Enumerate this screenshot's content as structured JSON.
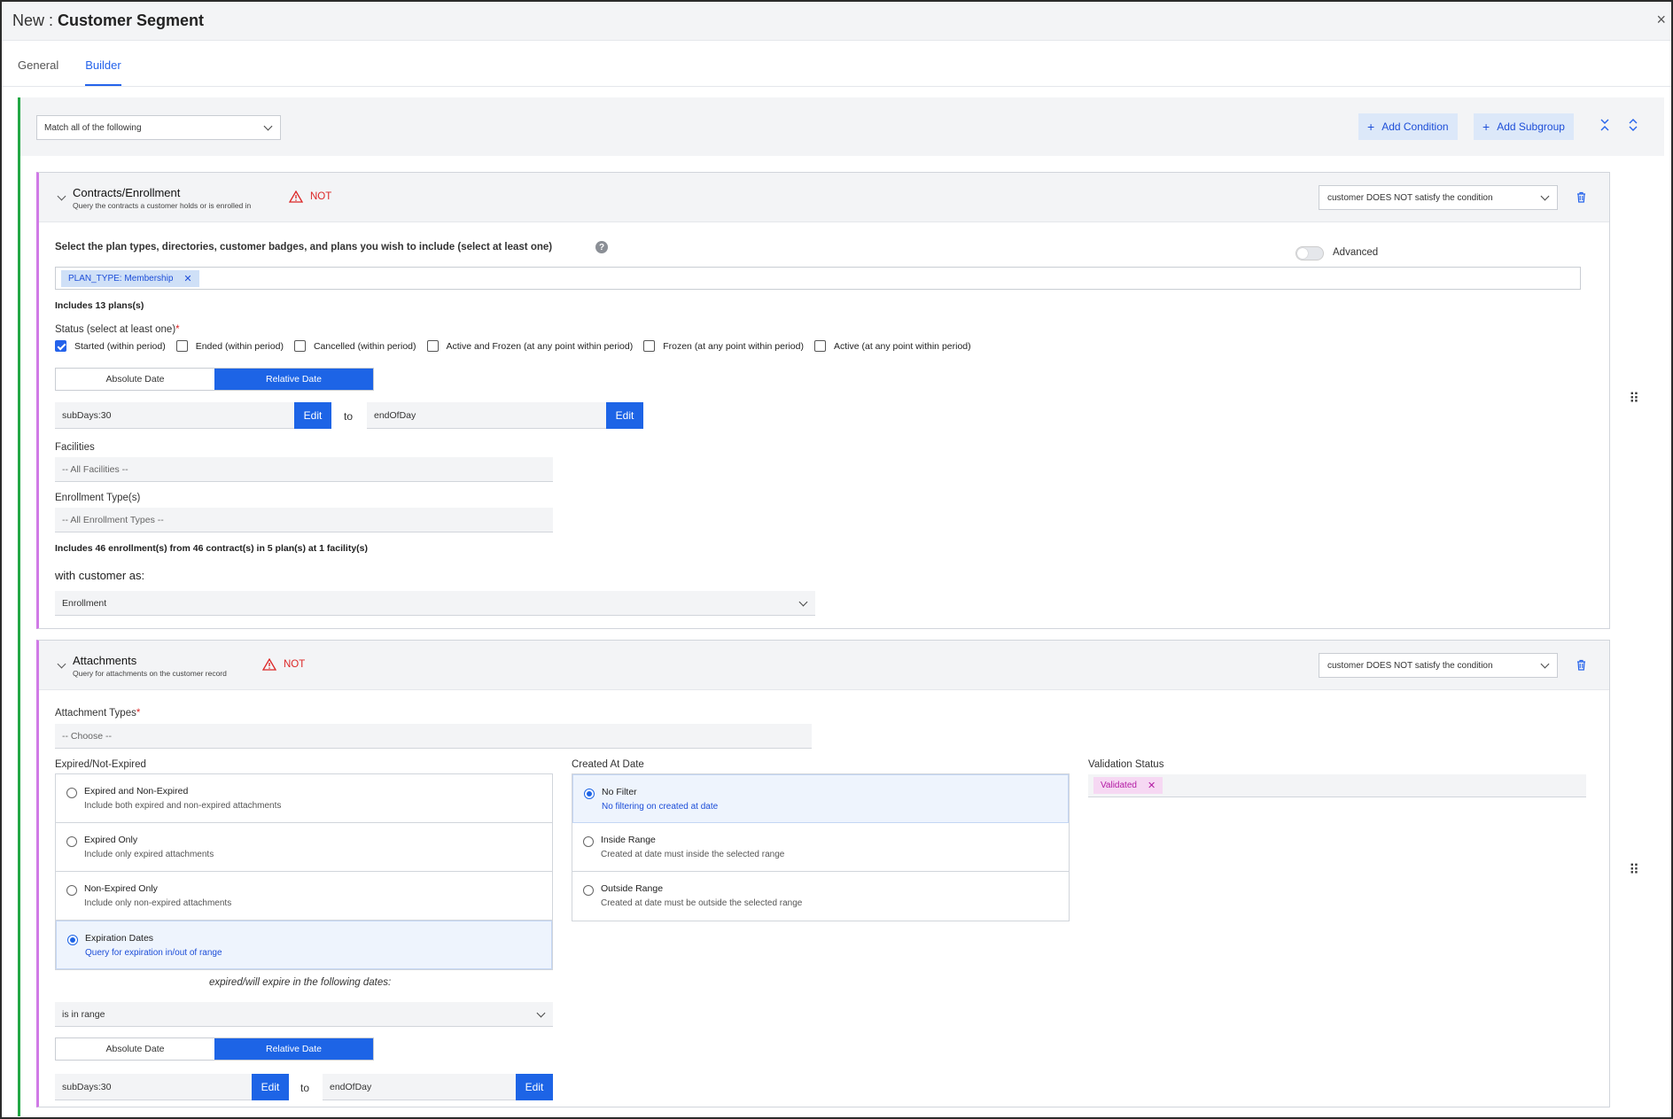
{
  "window": {
    "prefix": "New :",
    "title": "Customer Segment",
    "close": "×"
  },
  "tabs": [
    {
      "label": "General"
    },
    {
      "label": "Builder"
    }
  ],
  "toolbar": {
    "match": "Match all of the following",
    "add_condition": "Add Condition",
    "add_subgroup": "Add Subgroup"
  },
  "contracts": {
    "title": "Contracts/Enrollment",
    "subtitle": "Query the contracts a customer holds or is enrolled in",
    "not_label": "NOT",
    "condition": "customer DOES NOT satisfy the condition",
    "plans_label": "Select the plan types, directories, customer badges, and plans you wish to include (select at least one)",
    "advanced": "Advanced",
    "chip": "PLAN_TYPE: Membership",
    "includes_plans": "Includes 13 plans(s)",
    "status_label": "Status (select at least one)",
    "statuses": [
      {
        "label": "Started (within period)"
      },
      {
        "label": "Ended (within period)"
      },
      {
        "label": "Cancelled (within period)"
      },
      {
        "label": "Active and Frozen (at any point within period)"
      },
      {
        "label": "Frozen (at any point within period)"
      },
      {
        "label": "Active (at any point within period)"
      }
    ],
    "absolute_date": "Absolute Date",
    "relative_date": "Relative Date",
    "from_value": "subDays:30",
    "to_value": "endOfDay",
    "edit": "Edit",
    "to": "to",
    "facilities_label": "Facilities",
    "facilities_value": "-- All Facilities --",
    "enrollment_label": "Enrollment Type(s)",
    "enrollment_value": "-- All Enrollment Types --",
    "includes_enrollments": "Includes 46 enrollment(s) from 46 contract(s) in 5 plan(s) at 1 facility(s)",
    "customer_as_label": "with customer as:",
    "customer_as_value": "Enrollment"
  },
  "attachments": {
    "title": "Attachments",
    "subtitle": "Query for attachments on the customer record",
    "not_label": "NOT",
    "condition": "customer DOES NOT satisfy the condition",
    "types_label": "Attachment Types",
    "types_value": "-- Choose --",
    "expired_label": "Expired/Not-Expired",
    "expired_options": [
      {
        "title": "Expired and Non-Expired",
        "desc": "Include both expired and non-expired attachments"
      },
      {
        "title": "Expired Only",
        "desc": "Include only expired attachments"
      },
      {
        "title": "Non-Expired Only",
        "desc": "Include only non-expired attachments"
      },
      {
        "title": "Expiration Dates",
        "desc": "Query for expiration in/out of range"
      }
    ],
    "created_label": "Created At Date",
    "created_options": [
      {
        "title": "No Filter",
        "desc": "No filtering on created at date"
      },
      {
        "title": "Inside Range",
        "desc": "Created at date must inside the selected range"
      },
      {
        "title": "Outside Range",
        "desc": "Created at date must be outside the selected range"
      }
    ],
    "validation_label": "Validation Status",
    "validation_chip": "Validated",
    "expire_caption": "expired/will expire in the following dates:",
    "range_value": "is in range",
    "absolute_date": "Absolute Date",
    "relative_date": "Relative Date",
    "from_value": "subDays:30",
    "to_value": "endOfDay",
    "edit": "Edit",
    "to": "to"
  },
  "colors": {
    "accent": "#1d64e6",
    "group_border": "#22a745",
    "subgroup_border": "#d07ae6",
    "not": "#dc2626"
  }
}
